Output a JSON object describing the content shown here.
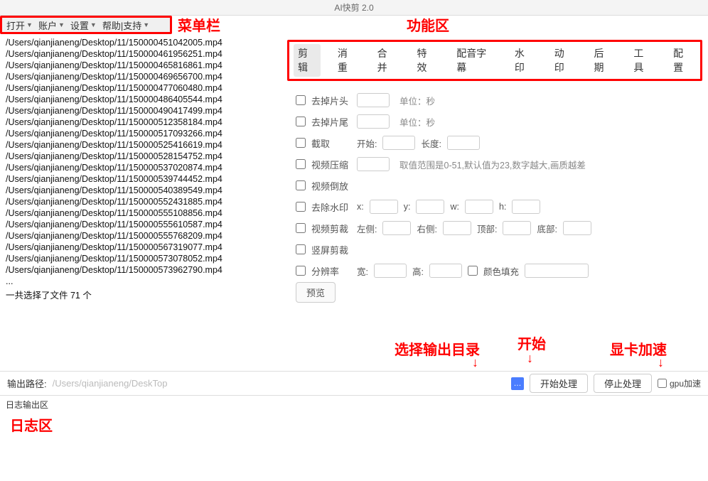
{
  "window": {
    "title": "AI快剪  2.0"
  },
  "menubar": {
    "items": [
      "打开",
      "账户",
      "设置",
      "帮助|支持"
    ]
  },
  "annotations": {
    "menubar_label": "菜单栏",
    "function_label": "功能区",
    "output_dir_label": "选择输出目录",
    "start_label": "开始",
    "gpu_label": "显卡加速",
    "log_label": "日志区"
  },
  "tabs": [
    "剪辑",
    "消重",
    "合并",
    "特效",
    "配音字幕",
    "水印",
    "动印",
    "后期",
    "工具",
    "配置"
  ],
  "active_tab_index": 0,
  "filelist": {
    "items": [
      "/Users/qianjianeng/Desktop/11/150000451042005.mp4",
      "/Users/qianjianeng/Desktop/11/150000461956251.mp4",
      "/Users/qianjianeng/Desktop/11/150000465816861.mp4",
      "/Users/qianjianeng/Desktop/11/150000469656700.mp4",
      "/Users/qianjianeng/Desktop/11/150000477060480.mp4",
      "/Users/qianjianeng/Desktop/11/150000486405544.mp4",
      "/Users/qianjianeng/Desktop/11/150000490417499.mp4",
      "/Users/qianjianeng/Desktop/11/150000512358184.mp4",
      "/Users/qianjianeng/Desktop/11/150000517093266.mp4",
      "/Users/qianjianeng/Desktop/11/150000525416619.mp4",
      "/Users/qianjianeng/Desktop/11/150000528154752.mp4",
      "/Users/qianjianeng/Desktop/11/150000537020874.mp4",
      "/Users/qianjianeng/Desktop/11/150000539744452.mp4",
      "/Users/qianjianeng/Desktop/11/150000540389549.mp4",
      "/Users/qianjianeng/Desktop/11/150000552431885.mp4",
      "/Users/qianjianeng/Desktop/11/150000555108856.mp4",
      "/Users/qianjianeng/Desktop/11/150000555610587.mp4",
      "/Users/qianjianeng/Desktop/11/150000555768209.mp4",
      "/Users/qianjianeng/Desktop/11/150000567319077.mp4",
      "/Users/qianjianeng/Desktop/11/150000573078052.mp4",
      "/Users/qianjianeng/Desktop/11/150000573962790.mp4"
    ],
    "ellipsis": "...",
    "summary": "一共选择了文件 71 个"
  },
  "options": {
    "cut_head": {
      "label": "去掉片头",
      "unit": "单位：秒"
    },
    "cut_tail": {
      "label": "去掉片尾",
      "unit": "单位：秒"
    },
    "extract": {
      "label": "截取",
      "start": "开始:",
      "length": "长度:"
    },
    "compress": {
      "label": "视频压缩",
      "note": "取值范围是0-51,默认值为23,数字越大,画质越差"
    },
    "reverse": {
      "label": "视频倒放"
    },
    "rm_wm": {
      "label": "去除水印",
      "x": "x:",
      "y": "y:",
      "w": "w:",
      "h": "h:"
    },
    "crop": {
      "label": "视频剪裁",
      "left": "左侧:",
      "right": "右侧:",
      "top": "顶部:",
      "bottom": "底部:"
    },
    "vertical": {
      "label": "竖屏剪裁"
    },
    "resolution": {
      "label": "分辨率",
      "w": "宽:",
      "h": "高:",
      "fill": "颜色填充"
    },
    "preview_btn": "预览"
  },
  "bottombar": {
    "path_label": "输出路径:",
    "path_value": "/Users/qianjianeng/DeskTop",
    "choose_icon": "…",
    "start_btn": "开始处理",
    "stop_btn": "停止处理",
    "gpu_label": "gpu加速"
  },
  "log": {
    "header": "日志输出区"
  }
}
